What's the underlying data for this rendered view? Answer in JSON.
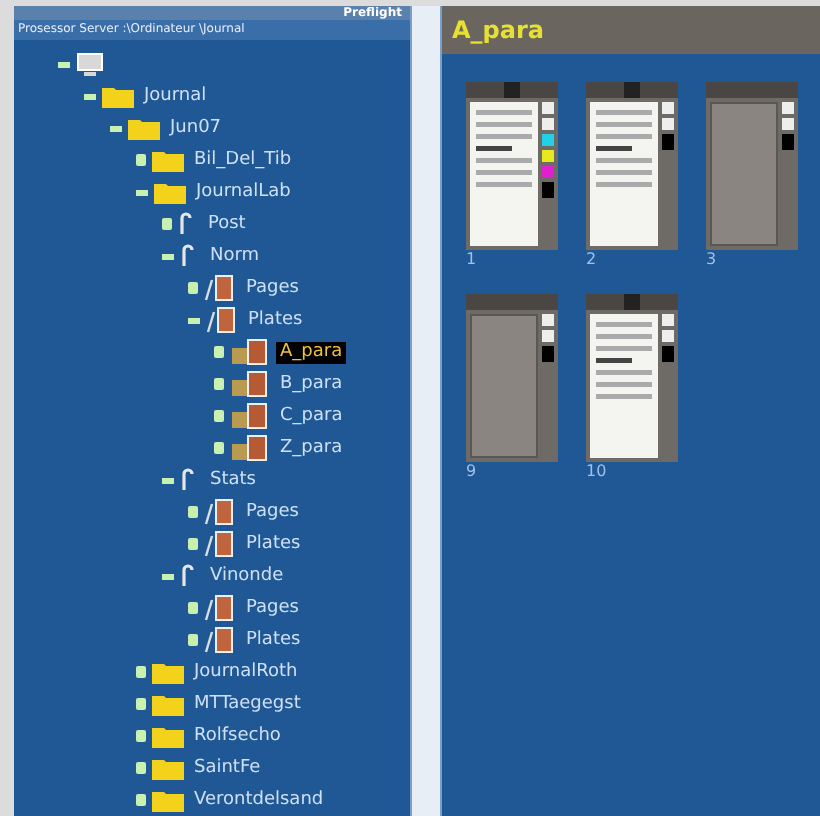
{
  "tree_panel": {
    "toolbar_label": "Preflight",
    "path": "Prosessor Server :\\Ordinateur \\Journal",
    "tree": [
      {
        "kind": "computer",
        "expanded": true,
        "children": [
          {
            "label": "Journal",
            "kind": "folder",
            "expanded": true,
            "selected": false,
            "children": [
              {
                "label": "Jun07",
                "kind": "folder",
                "expanded": true,
                "selected": false,
                "children": [
                  {
                    "label": "Bil_Del_Tib",
                    "kind": "folder",
                    "expanded": false,
                    "selected": false
                  },
                  {
                    "label": "JournalLab",
                    "kind": "folder",
                    "expanded": true,
                    "selected": false,
                    "children": [
                      {
                        "label": "Post",
                        "kind": "edition",
                        "expanded": false,
                        "selected": false
                      },
                      {
                        "label": "Norm",
                        "kind": "edition",
                        "expanded": true,
                        "selected": false,
                        "children": [
                          {
                            "label": "Pages",
                            "kind": "section",
                            "expanded": false,
                            "selected": false
                          },
                          {
                            "label": "Plates",
                            "kind": "section",
                            "expanded": true,
                            "selected": false,
                            "children": [
                              {
                                "label": "A_para",
                                "kind": "plate",
                                "expanded": false,
                                "selected": true
                              },
                              {
                                "label": "B_para",
                                "kind": "plate",
                                "expanded": false,
                                "selected": false
                              },
                              {
                                "label": "C_para",
                                "kind": "plate",
                                "expanded": false,
                                "selected": false
                              },
                              {
                                "label": "Z_para",
                                "kind": "plate",
                                "expanded": false,
                                "selected": false
                              }
                            ]
                          }
                        ]
                      },
                      {
                        "label": "Stats",
                        "kind": "edition",
                        "expanded": true,
                        "selected": false,
                        "children": [
                          {
                            "label": "Pages",
                            "kind": "section",
                            "expanded": false,
                            "selected": false
                          },
                          {
                            "label": "Plates",
                            "kind": "section",
                            "expanded": false,
                            "selected": false
                          }
                        ]
                      },
                      {
                        "label": "Vinonde",
                        "kind": "edition",
                        "expanded": true,
                        "selected": false,
                        "children": [
                          {
                            "label": "Pages",
                            "kind": "section",
                            "expanded": false,
                            "selected": false
                          },
                          {
                            "label": "Plates",
                            "kind": "section",
                            "expanded": false,
                            "selected": false
                          }
                        ]
                      }
                    ]
                  },
                  {
                    "label": "JournalRoth",
                    "kind": "folder",
                    "expanded": false,
                    "selected": false
                  },
                  {
                    "label": "MTTaegegst",
                    "kind": "folder",
                    "expanded": false,
                    "selected": false
                  },
                  {
                    "label": "Rolfsecho",
                    "kind": "folder",
                    "expanded": false,
                    "selected": false
                  },
                  {
                    "label": "SaintFe",
                    "kind": "folder",
                    "expanded": false,
                    "selected": false
                  },
                  {
                    "label": "Verontdelsand",
                    "kind": "folder",
                    "expanded": false,
                    "selected": false
                  }
                ]
              }
            ]
          }
        ]
      }
    ]
  },
  "content_panel": {
    "title": "A_para",
    "thumbnails": [
      {
        "label": "1",
        "kind": "printed",
        "separations": true
      },
      {
        "label": "2",
        "kind": "printed",
        "separations": false
      },
      {
        "label": "3",
        "kind": "blank",
        "separations": false
      },
      {
        "label": "9",
        "kind": "blank",
        "separations": false
      },
      {
        "label": "10",
        "kind": "printed",
        "separations": false
      }
    ]
  }
}
